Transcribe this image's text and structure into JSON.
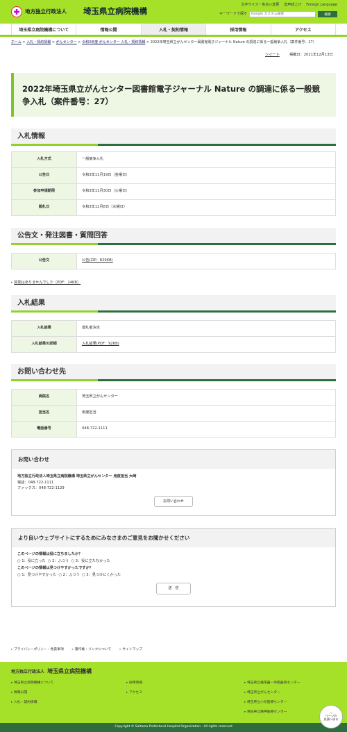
{
  "header": {
    "org_small": "地方独立行政法人",
    "org_big": "埼玉県立病院機構",
    "links": [
      "文字サイズ・色合い変更",
      "音声読上げ",
      "Foreign Language"
    ],
    "search_label": "キーワードで探す",
    "search_placeholder": "Google カスタム検索",
    "search_button": "検索"
  },
  "nav": [
    "埼玉県立病院機構について",
    "情報公開",
    "入札・契約情報",
    "採用情報",
    "アクセス"
  ],
  "breadcrumb": [
    "ホーム",
    "入札・契約情報",
    "がんセンター",
    "令和3年度 がんセンター 入札・契約情報",
    "2022年埼玉県立がんセンター図書館電子ジャーナル Nature の調達に係る一般競争入札（案件番号：27）"
  ],
  "tweet": "ツイート",
  "published": "掲載日：2021年12月13日",
  "title": "2022年埼玉県立がんセンター図書館電子ジャーナル Nature の調達に係る一般競争入札（案件番号：27）",
  "s1": {
    "heading": "入札情報",
    "rows": [
      [
        "入札方式",
        "一般競争入札"
      ],
      [
        "公告日",
        "令和3年11月19日（金曜日）"
      ],
      [
        "参加申請期限",
        "令和3年11月30日（火曜日）"
      ],
      [
        "開札日",
        "令和3年12月8日（水曜日）"
      ]
    ]
  },
  "s2": {
    "heading": "公告文・発注図書・質問回答",
    "label": "公告文",
    "link": "公告(ZIP：829KB)",
    "note": "質問はありませんでした（PDF：24KB）"
  },
  "s3": {
    "heading": "入札結果",
    "r1": [
      "入札結果",
      "落札者決定"
    ],
    "r2": [
      "入札結果の詳細",
      "入札結果(PDF：92KB)"
    ]
  },
  "s4": {
    "heading": "お問い合わせ先",
    "rows": [
      [
        "病院名",
        "埼玉県立がんセンター"
      ],
      [
        "担当名",
        "用度担当"
      ],
      [
        "電話番号",
        "048-722-1111"
      ]
    ]
  },
  "contact": {
    "heading": "お問い合わせ",
    "org": "地方独立行政法人埼玉県立病院機構 埼玉県立がんセンター 用度担当 大崎",
    "tel": "電話：048-722-1111",
    "fax": "ファックス：048-722-1129",
    "button": "お問い合わせ"
  },
  "feedback": {
    "heading": "より良いウェブサイトにするためにみなさまのご意見をお聞かせください",
    "q1": "このページの情報は役に立ちましたか？",
    "q1_opts": [
      "1：役に立った",
      "2：ふつう",
      "3：役に立たなかった"
    ],
    "q2": "このページの情報は見つけやすかったですか？",
    "q2_opts": [
      "1：見つけやすかった",
      "2：ふつう",
      "3：見つけにくかった"
    ],
    "submit": "送　信"
  },
  "footer_links": [
    "プライバシーポリシー・免責事項",
    "著作権・リンクについて",
    "サイトマップ"
  ],
  "footer": {
    "org_small": "地方独立行政法人",
    "org_big": "埼玉県立病院機構",
    "col1": [
      "埼玉県立病院機構について",
      "情報公開",
      "入札・契約情報"
    ],
    "col2": [
      "採用情報",
      "アクセス"
    ],
    "col3": [
      "埼玉県立循環器・呼吸器病センター",
      "埼玉県立がんセンター",
      "埼玉県立小児医療センター",
      "埼玉県立精神医療センター"
    ],
    "copyright": "Copyright © Saitama Prefectural Hospital Organization . All rights reserved",
    "pagetop": "ページの\n先頭へ戻る"
  }
}
